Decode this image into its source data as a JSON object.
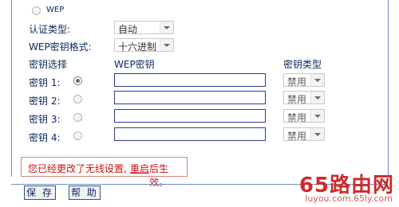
{
  "wep_option": {
    "label": "WEP"
  },
  "auth_type": {
    "label": "认证类型:",
    "value": "自动"
  },
  "wep_key_format": {
    "label": "WEP密钥格式:",
    "value": "十六进制"
  },
  "table": {
    "col_select": "密钥选择",
    "col_key": "WEP密钥",
    "col_type": "密钥类型",
    "rows": [
      {
        "label": "密钥 1:",
        "selected": true,
        "type": "禁用"
      },
      {
        "label": "密钥 2:",
        "selected": false,
        "type": "禁用"
      },
      {
        "label": "密钥 3:",
        "selected": false,
        "type": "禁用"
      },
      {
        "label": "密钥 4:",
        "selected": false,
        "type": "禁用"
      }
    ]
  },
  "notice": {
    "before": "您已经更改了无线设置,",
    "link": "重启",
    "after": "后生效。"
  },
  "buttons": {
    "save": "保 存",
    "help": "帮 助"
  },
  "watermark": {
    "main": "65路由网",
    "sub": "luyou.com.65ly.com"
  }
}
